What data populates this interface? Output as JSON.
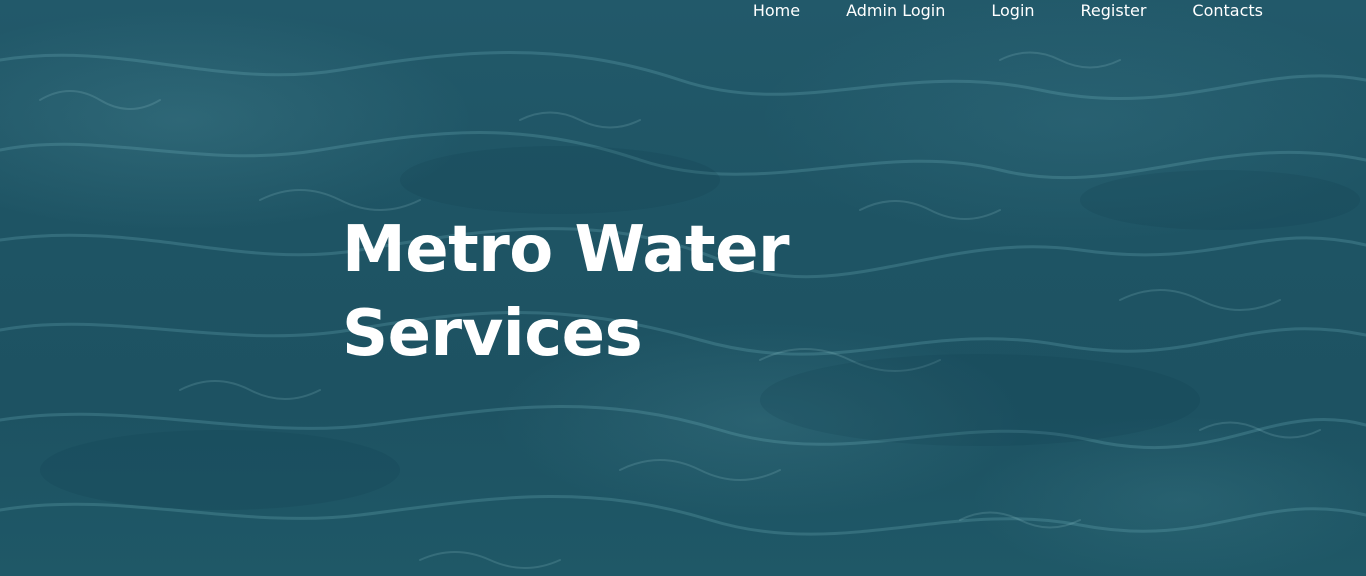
{
  "nav": {
    "items": [
      {
        "label": "Home"
      },
      {
        "label": "Admin Login"
      },
      {
        "label": "Login"
      },
      {
        "label": "Register"
      },
      {
        "label": "Contacts"
      }
    ]
  },
  "hero": {
    "title_line1": "Metro Water",
    "title_line2": "Services",
    "background": "water-surface-image"
  },
  "colors": {
    "water": "#1f5565",
    "text": "#ffffff"
  }
}
